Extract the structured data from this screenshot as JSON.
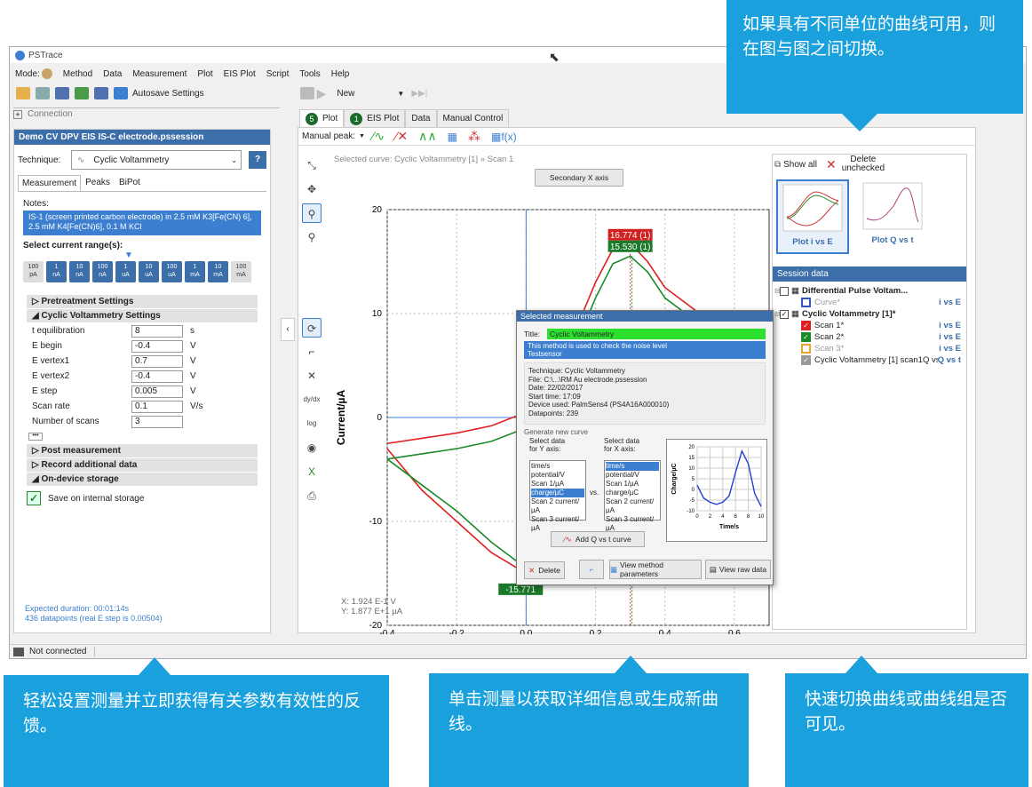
{
  "window": {
    "title": "PSTrace"
  },
  "menu": {
    "mode": "Mode:",
    "items": [
      "Method",
      "Data",
      "Measurement",
      "Plot",
      "EIS Plot",
      "Script",
      "Tools",
      "Help"
    ]
  },
  "toolbar": {
    "autosave": "Autosave Settings",
    "new": "New"
  },
  "connection": {
    "label": "Connection"
  },
  "left": {
    "file": "Demo CV DPV EIS IS-C electrode.pssession",
    "technique_label": "Technique:",
    "technique": "Cyclic Voltammetry",
    "help": "?",
    "tabs": [
      "Measurement",
      "Peaks",
      "BiPot"
    ],
    "notes_label": "Notes:",
    "notes": "IS-1 (screen printed carbon electrode) in 2.5 mM K3[Fe(CN) 6], 2.5 mM K4[Fe(CN)6], 0.1 M KCl",
    "range_label": "Select current range(s):",
    "ranges": [
      {
        "a": "100",
        "b": "pA",
        "on": false
      },
      {
        "a": "1",
        "b": "nA",
        "on": true
      },
      {
        "a": "10",
        "b": "nA",
        "on": true
      },
      {
        "a": "100",
        "b": "nA",
        "on": true
      },
      {
        "a": "1",
        "b": "uA",
        "on": true
      },
      {
        "a": "10",
        "b": "uA",
        "on": true
      },
      {
        "a": "100",
        "b": "uA",
        "on": true
      },
      {
        "a": "1",
        "b": "mA",
        "on": true
      },
      {
        "a": "10",
        "b": "mA",
        "on": true
      },
      {
        "a": "100",
        "b": "mA",
        "on": false
      }
    ],
    "pretreatment": "Pretreatment Settings",
    "cv_settings": "Cyclic Voltammetry Settings",
    "params": [
      {
        "label": "t equilibration",
        "value": "8",
        "unit": "s"
      },
      {
        "label": "E begin",
        "value": "-0.4",
        "unit": "V"
      },
      {
        "label": "E vertex1",
        "value": "0.7",
        "unit": "V"
      },
      {
        "label": "E vertex2",
        "value": "-0.4",
        "unit": "V"
      },
      {
        "label": "E step",
        "value": "0.005",
        "unit": "V"
      },
      {
        "label": "Scan rate",
        "value": "0.1",
        "unit": "V/s"
      },
      {
        "label": "Number of scans",
        "value": "3",
        "unit": ""
      }
    ],
    "more": "•••",
    "post": "Post measurement",
    "record": "Record additional data",
    "ondevice": "On-device storage",
    "save_internal": "Save on internal storage",
    "duration": "Expected duration: 00:01:14s",
    "datapoints": "436 datapoints (real E step is 0.00504)"
  },
  "tabs": [
    {
      "badge": "5",
      "label": "Plot"
    },
    {
      "badge": "1",
      "label": "EIS Plot"
    },
    {
      "badge": "",
      "label": "Data"
    },
    {
      "badge": "",
      "label": "Manual Control"
    }
  ],
  "manual_peak": "Manual peak:",
  "plot": {
    "selected": "Selected curve: Cyclic Voltammetry [1] » Scan 1",
    "secondary": "Secondary X axis",
    "xcoord": "X: 1.924 E-1 V",
    "ycoord": "Y: 1.877 E+1 µA",
    "peak_top1": "16.774 (1)",
    "peak_top2": "15.530 (1)",
    "peak_bottom": "-15.771"
  },
  "chart_data": {
    "type": "line",
    "xlabel": "Potential/V",
    "ylabel": "Current/µA",
    "xlim": [
      -0.4,
      0.7
    ],
    "ylim": [
      -20,
      20
    ],
    "xticks": [
      "-0.4",
      "-0.2",
      "0.0",
      "0.2",
      "0.4",
      "0.6"
    ],
    "yticks": [
      "-20",
      "-10",
      "0",
      "10",
      "20"
    ],
    "series": [
      {
        "color": "#e02020",
        "x": [
          -0.4,
          -0.3,
          -0.2,
          -0.1,
          0.0,
          0.1,
          0.15,
          0.2,
          0.25,
          0.3,
          0.35,
          0.4,
          0.5,
          0.6,
          0.7,
          0.6,
          0.5,
          0.4,
          0.3,
          0.2,
          0.15,
          0.1,
          0.05,
          0.0,
          -0.1,
          -0.2,
          -0.3,
          -0.4
        ],
        "y": [
          -2.5,
          -2.0,
          -1.5,
          -0.8,
          0.5,
          5,
          9,
          13,
          16.2,
          16.77,
          15,
          12.5,
          10,
          9,
          8.5,
          5,
          3,
          0,
          -3,
          -9,
          -13,
          -15.8,
          -15.77,
          -15,
          -13,
          -10,
          -7,
          -3
        ]
      },
      {
        "color": "#1a8a2a",
        "x": [
          -0.4,
          -0.3,
          -0.2,
          -0.1,
          0.0,
          0.1,
          0.15,
          0.2,
          0.25,
          0.3,
          0.35,
          0.4,
          0.5,
          0.6,
          0.7,
          0.6,
          0.5,
          0.4,
          0.3,
          0.2,
          0.15,
          0.1,
          0.05,
          0.0,
          -0.1,
          -0.2,
          -0.3,
          -0.4
        ],
        "y": [
          -4,
          -3.5,
          -3,
          -2.3,
          -1,
          3.5,
          7.5,
          11.5,
          14.8,
          15.53,
          14,
          11.5,
          9,
          8,
          7.5,
          4.5,
          2.5,
          -0.5,
          -3.5,
          -9.5,
          -13.5,
          -15.6,
          -15.4,
          -14.5,
          -12,
          -9,
          -6.5,
          -4
        ]
      }
    ]
  },
  "selected": {
    "header": "Selected measurement",
    "title_label": "Title:",
    "title": "Cyclic Voltammetry",
    "desc1": "This method is used to check the noise level",
    "desc2": "Testsensor",
    "info": [
      "Technique: Cyclic Voltammetry",
      "File: C:\\...\\RM Au electrode.pssession",
      "Date: 22/02/2017",
      "Start time: 17:09",
      "Device used: PalmSens4 (PS4A16A000010)",
      "Datapoints: 239"
    ],
    "generate": "Generate new curve",
    "y_label": "Select data\nfor Y axis:",
    "x_label": "Select data\nfor X axis:",
    "y_list": [
      "time/s",
      "potential/V",
      "Scan 1/µA",
      "charge/µC",
      "Scan 2 current/µA",
      "Scan 3 current/µA"
    ],
    "x_list": [
      "time/s",
      "potential/V",
      "Scan 1/µA",
      "charge/µC",
      "Scan 2 current/µA",
      "Scan 3 current/µA"
    ],
    "vs": "vs.",
    "add": "Add Q vs t curve",
    "delete": "Delete",
    "view_params": "View method parameters",
    "view_raw": "View raw data",
    "mini": {
      "xlabel": "Time/s",
      "ylabel": "Charge/µC",
      "xticks": [
        "0",
        "2",
        "4",
        "6",
        "8",
        "10"
      ],
      "yticks": [
        "20",
        "15",
        "10",
        "5",
        "0",
        "-5",
        "-10"
      ],
      "x": [
        0,
        1,
        2,
        3,
        4,
        5,
        6,
        7,
        8,
        9,
        10
      ],
      "y": [
        2,
        -4,
        -6,
        -7,
        -6,
        -3,
        8,
        18,
        12,
        -2,
        -8
      ]
    }
  },
  "right": {
    "show_all": "Show all",
    "delete": "Delete\nunchecked",
    "thumb1": "Plot i vs E",
    "thumb2": "Plot Q vs t",
    "session": "Session data",
    "tree": [
      {
        "label": "Differential Pulse Voltam...",
        "bold": true,
        "checked": false,
        "indent": 0,
        "color": "",
        "right": ""
      },
      {
        "label": "Curve*",
        "bold": false,
        "checked": false,
        "indent": 1,
        "color": "#3355cc",
        "right": "i vs E"
      },
      {
        "label": "Cyclic Voltammetry [1]*",
        "bold": true,
        "checked": true,
        "indent": 0,
        "color": "",
        "right": ""
      },
      {
        "label": "Scan 1*",
        "bold": false,
        "checked": true,
        "indent": 1,
        "color": "#e02020",
        "right": "i vs E"
      },
      {
        "label": "Scan 2*",
        "bold": false,
        "checked": true,
        "indent": 1,
        "color": "#1a8a2a",
        "right": "i vs E"
      },
      {
        "label": "Scan 3*",
        "bold": false,
        "checked": false,
        "indent": 1,
        "color": "#f0a030",
        "right": "i vs E"
      },
      {
        "label": "Cyclic Voltammetry [1] scan1Q vs t",
        "bold": false,
        "checked": true,
        "indent": 1,
        "color": "#999",
        "right": "Q vs t"
      }
    ]
  },
  "status": {
    "text": "Not connected"
  },
  "callouts": {
    "top": "如果具有不同单位的曲线可用，则在图与图之间切换。",
    "left": "轻松设置测量并立即获得有关参数有效性的反馈。",
    "mid": "单击测量以获取详细信息或生成新曲线。",
    "right": "快速切换曲线或曲线组是否可见。"
  }
}
